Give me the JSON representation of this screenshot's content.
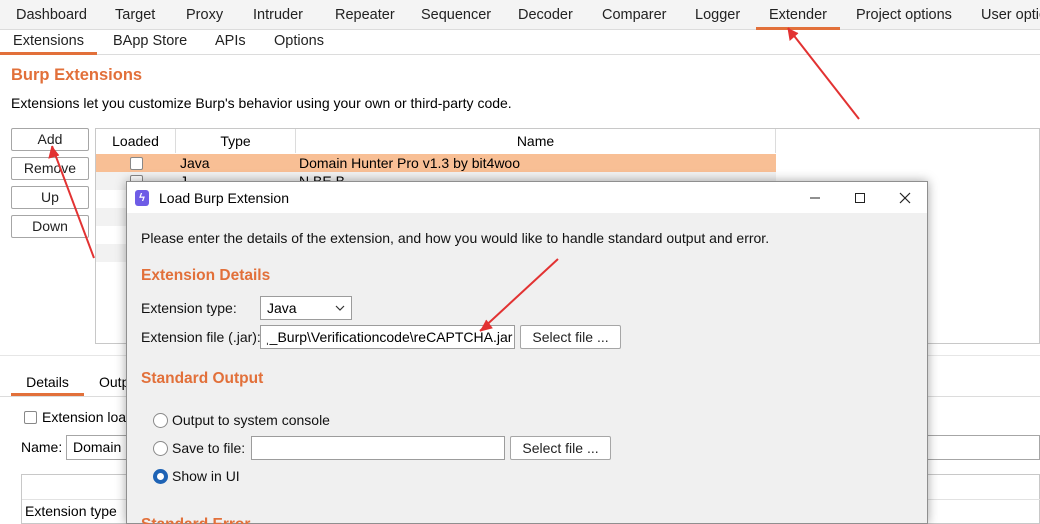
{
  "top_tabs": [
    "Dashboard",
    "Target",
    "Proxy",
    "Intruder",
    "Repeater",
    "Sequencer",
    "Decoder",
    "Comparer",
    "Logger",
    "Extender",
    "Project options",
    "User optio"
  ],
  "sub_tabs": [
    "Extensions",
    "BApp Store",
    "APIs",
    "Options"
  ],
  "extensions": {
    "heading": "Burp Extensions",
    "description": "Extensions let you customize Burp's behavior using your own or third-party code.",
    "buttons": {
      "add": "Add",
      "remove": "Remove",
      "up": "Up",
      "down": "Down"
    },
    "columns": {
      "loaded": "Loaded",
      "type": "Type",
      "name": "Name"
    },
    "rows": [
      {
        "type": "Java",
        "name": "Domain Hunter Pro v1.3 by bit4woo"
      },
      {
        "type": "J",
        "name": "N  BE  B"
      }
    ]
  },
  "details": {
    "tabs": [
      "Details",
      "Outp"
    ],
    "extension_loaded_label": "Extension load",
    "name_label": "Name:",
    "name_value": "Domain",
    "extension_type_label": "Extension type"
  },
  "dialog": {
    "title": "Load Burp Extension",
    "intro": "Please enter the details of the extension, and how you would like to handle standard output and error.",
    "section_details": "Extension Details",
    "extension_type_label": "Extension type:",
    "extension_type_value": "Java",
    "extension_file_label": "Extension file (.jar):",
    "extension_file_value": "ˌ_Burp\\Verificationcode\\reCAPTCHA.jar",
    "select_file": "Select file ...",
    "section_output": "Standard Output",
    "opt_console": "Output to system console",
    "opt_save": "Save to file:",
    "save_path": "",
    "select_file2": "Select file ...",
    "opt_ui": "Show in UI",
    "section_error": "Standard Error"
  },
  "colors": {
    "accent": "#e2703a",
    "selected_row": "#f8bf95",
    "arrow": "#e23232",
    "radio_selected": "#1e63b5"
  }
}
